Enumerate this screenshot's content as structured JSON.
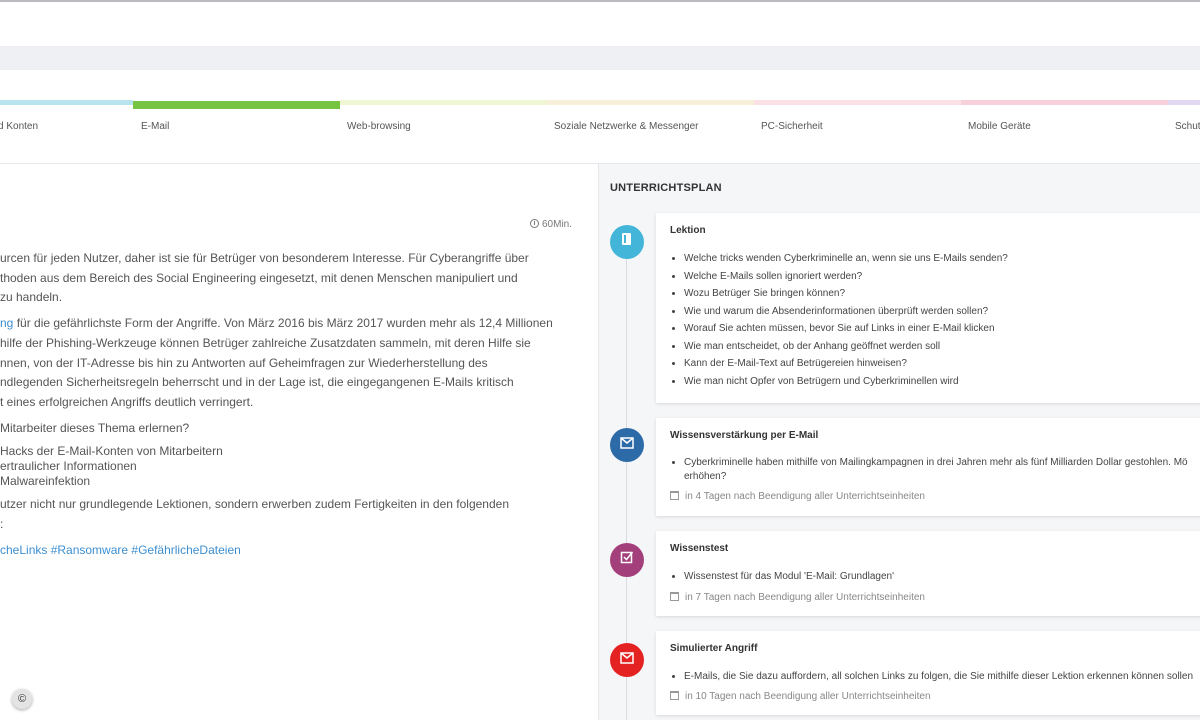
{
  "tabs": [
    {
      "label": "d Konten",
      "color": "#b8e4f0",
      "active": false
    },
    {
      "label": "E-Mail",
      "color": "#76c442",
      "active": true
    },
    {
      "label": "Web-browsing",
      "color": "#eef6d4",
      "active": false
    },
    {
      "label": "Soziale Netzwerke & Messenger",
      "color": "#f7efd8",
      "active": false
    },
    {
      "label": "PC-Sicherheit",
      "color": "#fbe0e6",
      "active": false
    },
    {
      "label": "Mobile Geräte",
      "color": "#f8d0dc",
      "active": false
    },
    {
      "label": "Schut",
      "color": "#e2d8f2",
      "active": false
    }
  ],
  "duration": "60Min.",
  "description": {
    "p1_l1": "urcen für jeden Nutzer, daher ist sie für Betrüger von besonderem Interesse. Für Cyberangriffe über",
    "p1_l2": "thoden aus dem Bereich des Social Engineering eingesetzt, mit denen Menschen manipuliert und",
    "p1_l3": " zu handeln.",
    "p2_link": "ng",
    "p2_l1_rest": " für die gefährlichste Form der Angriffe. Von März 2016 bis März 2017 wurden mehr als 12,4 Millionen",
    "p2_l2": "hilfe der Phishing-Werkzeuge können Betrüger zahlreiche Zusatzdaten sammeln, mit deren Hilfe sie",
    "p2_l3": "nnen, von der IT-Adresse bis hin zu Antworten auf Geheimfragen zur Wiederherstellung des",
    "p2_l4": "ndlegenden Sicherheitsregeln beherrscht und in der Lage ist, die eingegangenen E-Mails kritisch",
    "p2_l5": "t eines erfolgreichen Angriffs deutlich verringert.",
    "p3": " Mitarbeiter dieses Thema erlernen?",
    "list": [
      " Hacks der E-Mail-Konten von Mitarbeitern",
      "ertraulicher Informationen",
      "Malwareinfektion"
    ],
    "p4_l1": "utzer nicht nur grundlegende Lektionen, sondern erwerben zudem Fertigkeiten in den folgenden",
    "p4_l2": ":",
    "tags": "cheLinks #Ransomware #GefährlicheDateien"
  },
  "copyright_symbol": "©",
  "plan": {
    "title": "UNTERRICHTSPLAN",
    "items": [
      {
        "title": "Lektion",
        "icon": "book-icon",
        "color": "#43b5d9",
        "bullets": [
          "Welche tricks wenden Cyberkriminelle an, wenn sie uns E-Mails senden?",
          "Welche E-Mails sollen ignoriert werden?",
          "Wozu Betrüger Sie bringen können?",
          "Wie und warum die Absenderinformationen überprüft werden sollen?",
          "Worauf Sie achten müssen, bevor Sie auf Links in einer E-Mail klicken",
          "Wie man entscheidet, ob der Anhang geöffnet werden soll",
          "Kann der E-Mail-Text auf Betrügereien hinweisen?",
          "Wie man nicht Opfer von Betrügern und Cyberkriminellen wird"
        ],
        "meta": ""
      },
      {
        "title": "Wissensverstärkung per E-Mail",
        "icon": "envelope-icon",
        "color": "#2d6aa8",
        "bullets": [
          "Cyberkriminelle haben mithilfe von Mailingkampagnen in drei Jahren mehr als fünf Milliarden Dollar gestohlen. Mö",
          "erhöhen?"
        ],
        "meta": "in 4 Tagen nach Beendigung aller Unterrichtseinheiten"
      },
      {
        "title": "Wissenstest",
        "icon": "checkbox-icon",
        "color": "#a33f7a",
        "bullets": [
          "Wissenstest für das Modul 'E-Mail: Grundlagen'"
        ],
        "meta": "in 7 Tagen nach Beendigung aller Unterrichtseinheiten"
      },
      {
        "title": "Simulierter Angriff",
        "icon": "envelope-icon",
        "color": "#e52222",
        "bullets": [
          "E-Mails, die Sie dazu auffordern, all solchen Links zu folgen, die Sie mithilfe dieser Lektion erkennen können sollen"
        ],
        "meta": "in 10 Tagen nach Beendigung aller Unterrichtseinheiten"
      }
    ]
  }
}
